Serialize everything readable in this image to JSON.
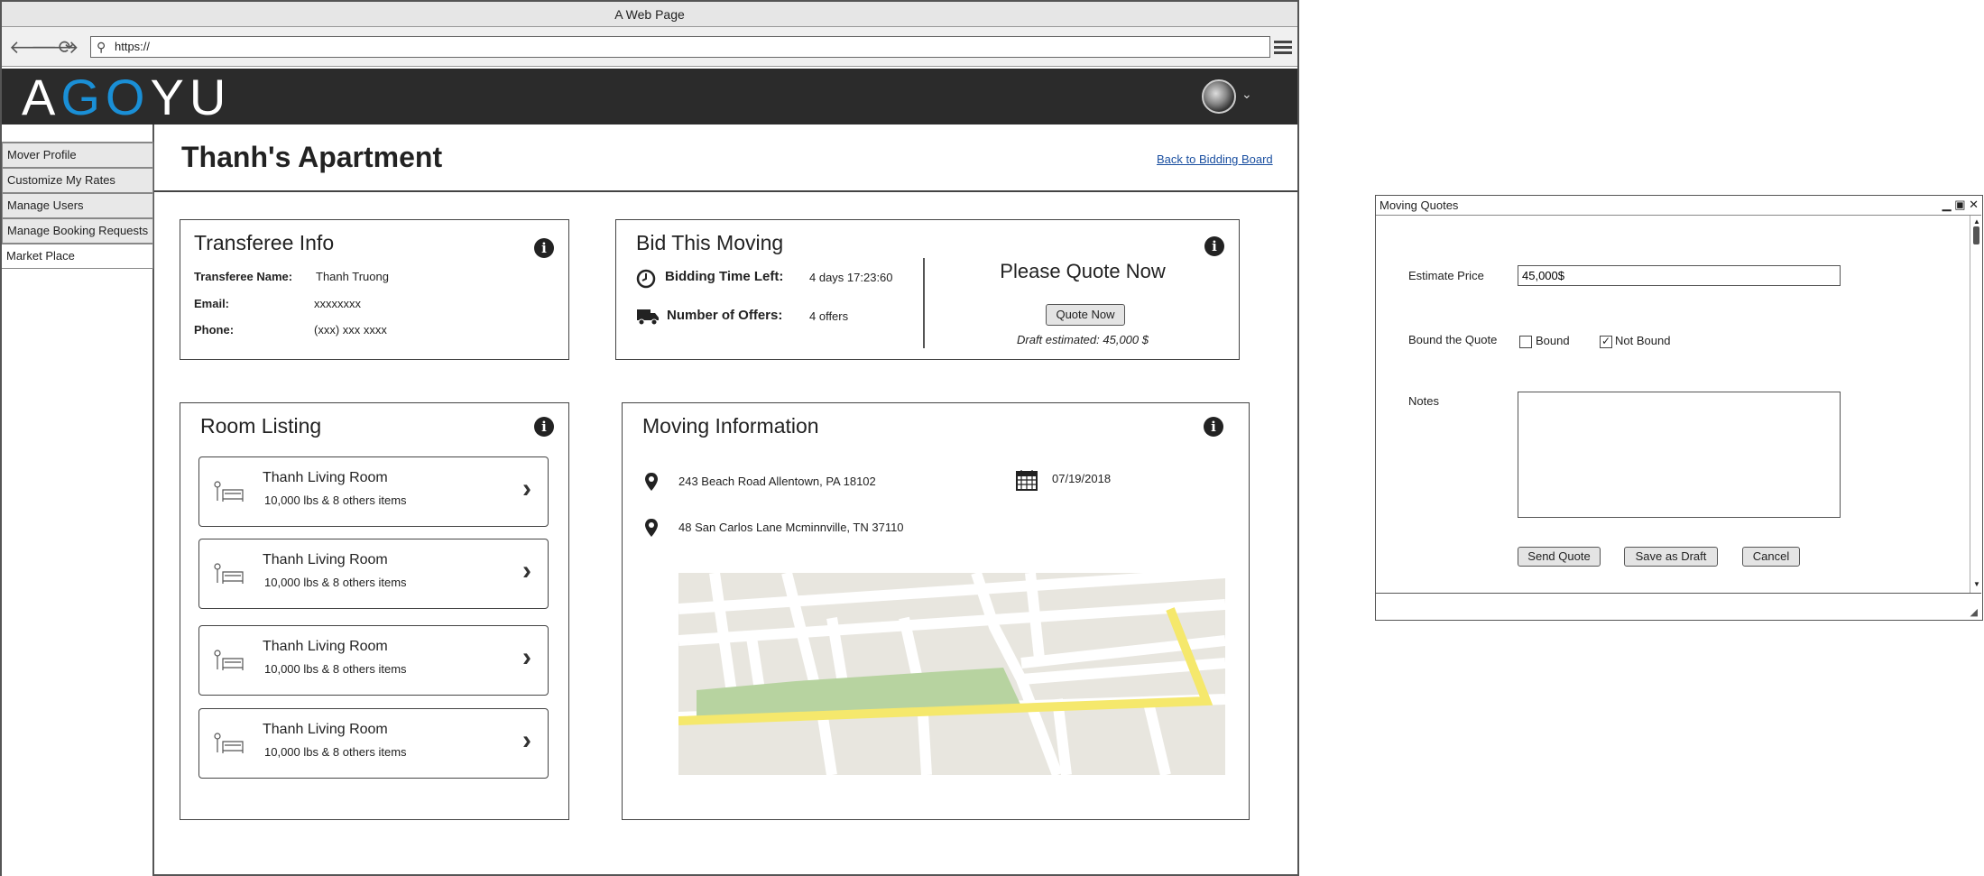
{
  "browser": {
    "title": "A Web Page",
    "url": "https://",
    "back_glyph": "🡐",
    "forward_glyph": "🡒",
    "reload_glyph": "⟳"
  },
  "header": {
    "logo_a": "A",
    "logo_g": "G",
    "logo_o": "O",
    "logo_rest": "YU",
    "avatar_caret": "⌄"
  },
  "sidebar": {
    "items": [
      {
        "label": "Mover Profile"
      },
      {
        "label": "Customize My Rates"
      },
      {
        "label": "Manage Users"
      },
      {
        "label": "Manage Booking Requests"
      },
      {
        "label": "Market Place"
      }
    ]
  },
  "page": {
    "title": "Thanh's Apartment",
    "back_link": "Back to Bidding Board"
  },
  "transferee": {
    "title": "Transferee Info",
    "name_label": "Transferee Name:",
    "name_value": "Thanh Truong",
    "email_label": "Email:",
    "email_value": "xxxxxxxx",
    "phone_label": "Phone:",
    "phone_value": "(xxx) xxx xxxx"
  },
  "bid": {
    "title": "Bid This Moving",
    "time_label": "Bidding Time Left:",
    "time_value": "4 days 17:23:60",
    "offers_label": "Number of Offers:",
    "offers_value": "4 offers",
    "quote_heading": "Please Quote Now",
    "quote_button": "Quote Now",
    "draft_text": "Draft estimated: 45,000 $"
  },
  "rooms": {
    "title": "Room Listing",
    "items": [
      {
        "name": "Thanh Living Room",
        "detail": "10,000 lbs & 8 others items"
      },
      {
        "name": "Thanh Living Room",
        "detail": "10,000 lbs & 8 others items"
      },
      {
        "name": "Thanh Living Room",
        "detail": "10,000 lbs & 8 others items"
      },
      {
        "name": "Thanh Living Room",
        "detail": "10,000 lbs & 8 others items"
      }
    ],
    "chevron": "›"
  },
  "moving": {
    "title": "Moving Information",
    "address_from": "243 Beach Road Allentown, PA 18102",
    "address_to": "48 San Carlos Lane Mcminnville, TN 37110",
    "date": "07/19/2018"
  },
  "modal": {
    "title": "Moving Quotes",
    "estimate_label": "Estimate Price",
    "estimate_value": "45,000$",
    "bound_label": "Bound the Quote",
    "option_bound": "Bound",
    "option_not_bound": "Not Bound",
    "bound_checked": false,
    "not_bound_checked": true,
    "check_glyph": "✓",
    "notes_label": "Notes",
    "notes_value": "",
    "send_button": "Send Quote",
    "draft_button": "Save as Draft",
    "cancel_button": "Cancel",
    "window_controls": "▁ ▣ ✕"
  },
  "colors": {
    "header_bg": "#2b2b2b",
    "logo_accent": "#1a8fd6",
    "link": "#1a4fa0",
    "map_road_highlight": "#f5e86c",
    "map_park": "#b7d3a0"
  }
}
